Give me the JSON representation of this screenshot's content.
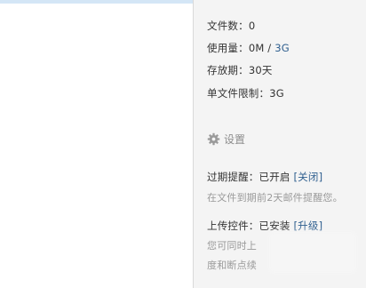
{
  "stats": {
    "file_count_label": "文件数：",
    "file_count_value": "0",
    "usage_label": "使用量：",
    "usage_used": "0M",
    "usage_sep": " / ",
    "usage_total": "3G",
    "retention_label": "存放期：",
    "retention_value": "30天",
    "single_limit_label": "单文件限制：",
    "single_limit_value": "3G"
  },
  "settings": {
    "icon": "gear-icon",
    "title": "设置"
  },
  "expiry_reminder": {
    "label": "过期提醒：",
    "status": "已开启",
    "action_open": " [",
    "action": "关闭",
    "action_close": "]",
    "hint": "在文件到期前2天邮件提醒您。"
  },
  "upload_plugin": {
    "label": "上传控件：",
    "status": "已安装",
    "action_open": " [",
    "action": "升级",
    "action_close": "]",
    "hint_line1_start": "您可同时上",
    "hint_line1_end": "进",
    "hint_line2_start": "度和断点续"
  },
  "colors": {
    "accent": "#2f5f8f",
    "sidebar_bg": "#f4f4f4",
    "hint_text": "#9a9a9a"
  }
}
